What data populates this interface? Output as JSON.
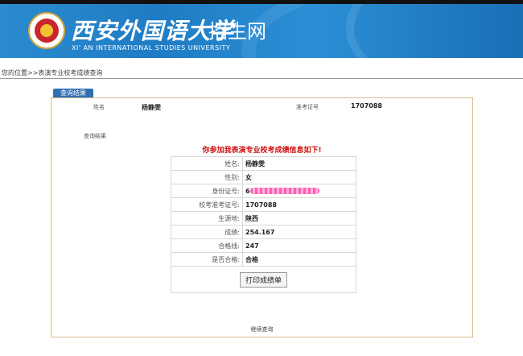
{
  "header": {
    "school_cn": "西安外国语大学",
    "suffix": "招生网",
    "school_en": "XI' AN INTERNATIONAL STUDIES UNIVERSITY",
    "logo_name": "university-seal"
  },
  "breadcrumb": "您的位置>>表演专业校考成绩查询",
  "tab_label": "查询结果",
  "summary": {
    "name_label": "姓名",
    "name_value": "杨静雯",
    "ticket_label": "准考证号",
    "ticket_value": "1707088",
    "section_label": "查询结果"
  },
  "notice": "你参加我表演专业校考成绩信息如下!",
  "result": [
    {
      "label": "姓名:",
      "value": "杨静雯"
    },
    {
      "label": "性别:",
      "value": "女"
    },
    {
      "label": "身份证号:",
      "value": "6",
      "masked": true
    },
    {
      "label": "校考准考证号:",
      "value": "1707088"
    },
    {
      "label": "生源地:",
      "value": "陕西"
    },
    {
      "label": "成绩:",
      "value": "254.167"
    },
    {
      "label": "合格线:",
      "value": "247"
    },
    {
      "label": "是否合格:",
      "value": "合格"
    }
  ],
  "print_button": "打印成绩单",
  "footer_link": "继续查询",
  "colors": {
    "banner": "#1f7cc4",
    "tab": "#2f6fb3",
    "notice": "#d01010",
    "panel_border": "#d6b98a"
  }
}
